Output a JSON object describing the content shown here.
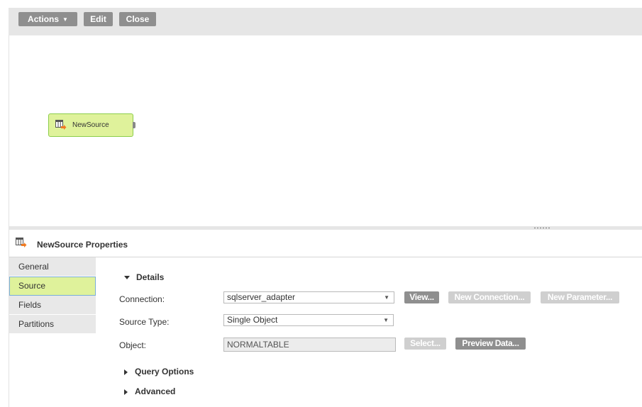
{
  "toolbar": {
    "actions_label": "Actions",
    "edit_label": "Edit",
    "close_label": "Close"
  },
  "canvas": {
    "node_label": "NewSource"
  },
  "properties": {
    "title": "NewSource Properties",
    "tabs": [
      {
        "label": "General",
        "active": false
      },
      {
        "label": "Source",
        "active": true
      },
      {
        "label": "Fields",
        "active": false
      },
      {
        "label": "Partitions",
        "active": false
      }
    ],
    "details": {
      "section_label": "Details",
      "connection_label": "Connection:",
      "connection_value": "sqlserver_adapter",
      "view_button": "View...",
      "new_connection_button": "New Connection...",
      "new_parameter_button": "New Parameter...",
      "source_type_label": "Source Type:",
      "source_type_value": "Single Object",
      "object_label": "Object:",
      "object_value": "NORMALTABLE",
      "select_button": "Select...",
      "preview_button": "Preview Data..."
    },
    "query_options_label": "Query Options",
    "advanced_label": "Advanced"
  },
  "colors": {
    "node_fill": "#dff29b",
    "node_border": "#8ccd4a",
    "button_gray": "#8f8f8f",
    "button_disabled": "#cfcfcf",
    "active_tab_border": "#7aaed8"
  }
}
